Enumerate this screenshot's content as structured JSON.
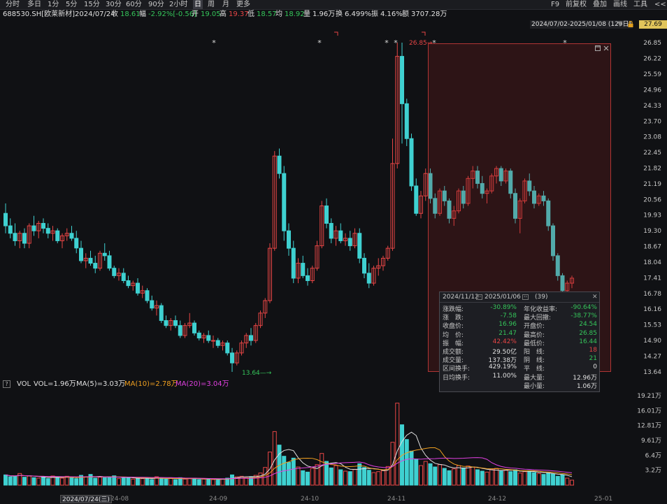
{
  "toolbar": {
    "periods": [
      "分时",
      "多日",
      "1分",
      "5分",
      "15分",
      "30分",
      "60分",
      "90分",
      "2小时",
      "日",
      "周",
      "月",
      "更多"
    ],
    "active_period": "日",
    "right_items": [
      "F9",
      "前复权",
      "叠加",
      "画线",
      "工具",
      "<<"
    ]
  },
  "info": {
    "code": "688530.SH[欧莱新材]",
    "date": "2024/07/24",
    "close_label": "收",
    "close": "18.61",
    "change_label": "幅",
    "change": "-2.92%[-0.56]",
    "open_label": "开",
    "open": "19.05",
    "high_label": "高",
    "high": "19.37",
    "low_label": "低",
    "low": "18.57",
    "avg_label": "均",
    "avg": "18.92",
    "volume_label": "量",
    "volume": "1.96万",
    "turnover_label": "换",
    "turnover": "6.499%",
    "amplitude_label": "振",
    "amplitude": "4.16%",
    "amount_label": "额",
    "amount": "3707.28万"
  },
  "range_label": "2024/07/02-2025/01/08 (129日)",
  "current_price": "27.69",
  "y_axis": [
    "26.85",
    "26.22",
    "25.59",
    "24.96",
    "24.33",
    "23.70",
    "23.08",
    "22.45",
    "21.82",
    "21.19",
    "20.56",
    "19.93",
    "19.30",
    "18.67",
    "18.04",
    "17.41",
    "16.78",
    "16.16",
    "15.53",
    "14.90",
    "14.27",
    "13.64"
  ],
  "annotations": {
    "high_label": "26.85",
    "low_label": "13.64"
  },
  "stat_panel": {
    "range": "2024/11/12",
    "range_end": "2025/01/06",
    "count": "(39)",
    "rows": [
      {
        "l1": "涨跌幅:",
        "v1": "-30.89%",
        "c1": "#35c55a",
        "l2": "年化收益率:",
        "v2": "-90.64%",
        "c2": "#35c55a"
      },
      {
        "l1": "涨　跌:",
        "v1": "-7.58",
        "c1": "#35c55a",
        "l2": "最大回撤:",
        "v2": "-38.77%",
        "c2": "#35c55a"
      },
      {
        "l1": "收盘价:",
        "v1": "16.96",
        "c1": "#35c55a",
        "l2": "开盘价:",
        "v2": "24.54",
        "c2": "#35c55a"
      },
      {
        "l1": "均　价:",
        "v1": "21.47",
        "c1": "#35c55a",
        "l2": "最高价:",
        "v2": "26.85",
        "c2": "#35c55a"
      },
      {
        "l1": "振　幅:",
        "v1": "42.42%",
        "c1": "#e64545",
        "l2": "最低价:",
        "v2": "16.44",
        "c2": "#35c55a"
      },
      {
        "l1": "成交额:",
        "v1": "29.50亿",
        "c1": "#e0e0e0",
        "l2": "阳　线:",
        "v2": "18",
        "c2": "#e64545"
      },
      {
        "l1": "成交量:",
        "v1": "137.38万",
        "c1": "#e0e0e0",
        "l2": "阴　线:",
        "v2": "21",
        "c2": "#35c55a"
      },
      {
        "l1": "区间换手:",
        "v1": "429.19%",
        "c1": "#e0e0e0",
        "l2": "平　线:",
        "v2": "0",
        "c2": "#e0e0e0"
      },
      {
        "l1": "日均换手:",
        "v1": "11.00%",
        "c1": "#e0e0e0",
        "l2": "最大量:",
        "v2": "12.96万",
        "c2": "#e0e0e0"
      },
      {
        "l1": "",
        "v1": "",
        "c1": "#e0e0e0",
        "l2": "最小量:",
        "v2": "1.06万",
        "c2": "#e0e0e0"
      }
    ]
  },
  "volume_legend": {
    "question": "?",
    "name": "VOL",
    "vol": "VOL=1.96万",
    "ma5": "MA(5)=3.03万",
    "ma10": "MA(10)=2.78万",
    "ma20": "MA(20)=3.04万"
  },
  "vol_axis": [
    "19.21万",
    "16.01万",
    "12.81万",
    "9.61万",
    "6.4万",
    "3.2万"
  ],
  "x_axis": [
    "24-08",
    "24-09",
    "24-10",
    "24-11",
    "24-12",
    "25-01"
  ],
  "current_date": "2024/07/24(三)",
  "colors": {
    "up": "#e64545",
    "down": "#3fd1d1",
    "ma5": "#e0e0e0",
    "ma10": "#f0a020",
    "ma20": "#e040e0",
    "bg": "#101114"
  },
  "chart_data": {
    "type": "candlestick",
    "price_range": [
      13.64,
      26.85
    ],
    "candles": [
      [
        20.0,
        20.4,
        19.2,
        19.5
      ],
      [
        19.5,
        19.8,
        19.0,
        19.2
      ],
      [
        19.2,
        19.6,
        18.7,
        18.9
      ],
      [
        18.9,
        19.3,
        18.6,
        19.2
      ],
      [
        19.2,
        19.4,
        18.6,
        18.8
      ],
      [
        18.8,
        19.6,
        18.6,
        19.5
      ],
      [
        19.5,
        19.9,
        19.1,
        19.3
      ],
      [
        19.3,
        19.7,
        19.0,
        19.6
      ],
      [
        19.6,
        19.8,
        19.2,
        19.4
      ],
      [
        19.4,
        19.6,
        19.0,
        19.2
      ],
      [
        19.2,
        19.5,
        18.9,
        19.3
      ],
      [
        19.3,
        19.4,
        18.8,
        18.9
      ],
      [
        18.9,
        19.2,
        18.6,
        19.1
      ],
      [
        19.1,
        19.4,
        18.9,
        19.2
      ],
      [
        19.2,
        19.5,
        18.9,
        19.0
      ],
      [
        19.0,
        19.3,
        18.4,
        18.61
      ],
      [
        18.6,
        18.9,
        18.0,
        18.1
      ],
      [
        18.1,
        18.4,
        17.8,
        18.2
      ],
      [
        18.2,
        18.5,
        17.9,
        18.0
      ],
      [
        18.0,
        18.3,
        17.6,
        17.8
      ],
      [
        17.8,
        18.5,
        17.7,
        18.4
      ],
      [
        18.4,
        18.8,
        18.1,
        18.3
      ],
      [
        18.3,
        18.5,
        17.7,
        17.8
      ],
      [
        17.8,
        17.9,
        17.4,
        17.5
      ],
      [
        17.5,
        17.8,
        17.3,
        17.6
      ],
      [
        17.6,
        17.8,
        17.2,
        17.3
      ],
      [
        17.3,
        17.5,
        17.0,
        17.1
      ],
      [
        17.1,
        17.3,
        16.9,
        17.2
      ],
      [
        17.2,
        17.4,
        16.7,
        16.8
      ],
      [
        16.8,
        17.1,
        16.6,
        16.9
      ],
      [
        16.9,
        17.0,
        16.4,
        16.5
      ],
      [
        16.5,
        16.7,
        16.1,
        16.2
      ],
      [
        16.2,
        16.5,
        15.9,
        16.3
      ],
      [
        16.3,
        16.4,
        15.6,
        15.7
      ],
      [
        15.7,
        15.9,
        15.4,
        15.5
      ],
      [
        15.5,
        15.8,
        15.3,
        15.7
      ],
      [
        15.7,
        15.9,
        15.4,
        15.5
      ],
      [
        15.5,
        15.7,
        15.0,
        15.1
      ],
      [
        15.1,
        15.6,
        15.0,
        15.5
      ],
      [
        15.5,
        16.0,
        15.4,
        15.6
      ],
      [
        15.6,
        15.7,
        15.1,
        15.2
      ],
      [
        15.2,
        15.3,
        14.9,
        15.0
      ],
      [
        15.0,
        15.2,
        14.8,
        15.1
      ],
      [
        15.1,
        15.3,
        14.8,
        14.9
      ],
      [
        14.9,
        15.1,
        14.6,
        14.9
      ],
      [
        14.9,
        15.0,
        14.6,
        14.7
      ],
      [
        14.7,
        14.9,
        14.5,
        14.8
      ],
      [
        14.8,
        14.9,
        14.3,
        14.4
      ],
      [
        14.4,
        14.6,
        13.64,
        14.0
      ],
      [
        14.0,
        14.5,
        13.9,
        14.4
      ],
      [
        14.4,
        14.9,
        14.3,
        14.8
      ],
      [
        14.8,
        15.2,
        14.6,
        15.1
      ],
      [
        15.1,
        15.4,
        14.7,
        14.9
      ],
      [
        14.9,
        15.6,
        14.8,
        15.5
      ],
      [
        15.5,
        16.1,
        15.4,
        16.0
      ],
      [
        16.0,
        16.6,
        15.8,
        16.5
      ],
      [
        16.5,
        18.8,
        16.4,
        18.6
      ],
      [
        18.6,
        22.5,
        18.5,
        22.3
      ],
      [
        22.3,
        22.6,
        21.4,
        21.6
      ],
      [
        21.6,
        21.9,
        18.9,
        19.3
      ],
      [
        19.3,
        19.6,
        18.3,
        18.6
      ],
      [
        18.6,
        18.9,
        17.2,
        17.4
      ],
      [
        17.4,
        18.2,
        17.2,
        18.0
      ],
      [
        18.0,
        18.3,
        17.4,
        17.5
      ],
      [
        17.5,
        17.8,
        17.1,
        17.3
      ],
      [
        17.3,
        17.9,
        17.2,
        17.8
      ],
      [
        17.8,
        18.9,
        17.7,
        18.7
      ],
      [
        18.7,
        20.5,
        18.6,
        20.3
      ],
      [
        20.3,
        20.6,
        19.4,
        19.6
      ],
      [
        19.6,
        19.8,
        18.8,
        19.0
      ],
      [
        19.0,
        19.5,
        18.7,
        19.3
      ],
      [
        19.3,
        19.6,
        18.8,
        18.9
      ],
      [
        18.9,
        19.2,
        18.7,
        19.0
      ],
      [
        19.0,
        19.3,
        18.5,
        18.7
      ],
      [
        18.7,
        19.4,
        18.6,
        19.2
      ],
      [
        19.2,
        19.4,
        18.0,
        18.2
      ],
      [
        18.2,
        18.4,
        17.4,
        17.6
      ],
      [
        17.6,
        18.0,
        17.0,
        17.2
      ],
      [
        17.2,
        17.9,
        17.1,
        17.8
      ],
      [
        17.8,
        18.2,
        17.5,
        17.9
      ],
      [
        17.9,
        18.3,
        17.7,
        18.2
      ],
      [
        18.2,
        18.7,
        18.1,
        18.6
      ],
      [
        18.6,
        23.0,
        18.5,
        22.0
      ],
      [
        22.0,
        26.85,
        21.8,
        26.3
      ],
      [
        26.3,
        26.85,
        22.8,
        24.4
      ],
      [
        24.4,
        24.6,
        22.7,
        23.0
      ],
      [
        23.0,
        23.2,
        20.9,
        21.1
      ],
      [
        21.1,
        21.4,
        19.9,
        20.0
      ],
      [
        20.0,
        20.9,
        19.8,
        20.7
      ],
      [
        20.7,
        21.8,
        20.5,
        21.6
      ],
      [
        21.6,
        21.8,
        20.4,
        20.6
      ],
      [
        20.6,
        20.8,
        19.8,
        20.0
      ],
      [
        20.0,
        21.0,
        19.9,
        20.9
      ],
      [
        20.9,
        21.1,
        20.3,
        20.5
      ],
      [
        20.5,
        20.6,
        19.6,
        19.8
      ],
      [
        19.8,
        20.3,
        19.5,
        20.1
      ],
      [
        20.1,
        21.0,
        20.0,
        20.9
      ],
      [
        20.9,
        21.1,
        20.2,
        20.4
      ],
      [
        20.4,
        21.5,
        20.3,
        21.4
      ],
      [
        21.4,
        21.9,
        21.0,
        21.7
      ],
      [
        21.7,
        21.9,
        21.0,
        21.2
      ],
      [
        21.2,
        21.5,
        20.6,
        20.8
      ],
      [
        20.8,
        21.0,
        20.4,
        20.9
      ],
      [
        20.9,
        21.6,
        20.8,
        21.5
      ],
      [
        21.5,
        21.9,
        21.2,
        21.8
      ],
      [
        21.8,
        21.9,
        21.1,
        21.3
      ],
      [
        21.3,
        21.8,
        21.2,
        21.7
      ],
      [
        21.7,
        21.8,
        20.6,
        20.8
      ],
      [
        20.8,
        21.0,
        19.6,
        19.8
      ],
      [
        19.8,
        20.6,
        19.2,
        20.5
      ],
      [
        20.5,
        21.4,
        20.4,
        21.3
      ],
      [
        21.3,
        21.6,
        20.7,
        20.9
      ],
      [
        20.9,
        21.1,
        20.2,
        20.4
      ],
      [
        20.4,
        20.8,
        20.3,
        20.7
      ],
      [
        20.7,
        20.9,
        20.3,
        20.5
      ],
      [
        20.5,
        20.6,
        19.3,
        19.5
      ],
      [
        19.5,
        19.6,
        18.1,
        18.3
      ],
      [
        18.3,
        18.4,
        17.3,
        17.5
      ],
      [
        17.5,
        17.6,
        16.8,
        16.9
      ],
      [
        16.9,
        17.3,
        16.7,
        17.2
      ],
      [
        17.2,
        17.5,
        17.0,
        17.4
      ]
    ],
    "volumes": [
      2.2,
      1.8,
      1.9,
      2.5,
      1.7,
      2.0,
      1.6,
      1.5,
      1.8,
      1.4,
      1.96,
      1.7,
      1.5,
      1.9,
      1.6,
      1.4,
      2.1,
      1.8,
      2.3,
      1.5,
      1.7,
      1.6,
      1.8,
      2.0,
      1.4,
      1.5,
      1.7,
      1.3,
      1.5,
      1.4,
      1.6,
      1.2,
      1.8,
      1.4,
      1.3,
      1.5,
      1.2,
      1.6,
      1.3,
      1.4,
      1.5,
      1.2,
      1.3,
      1.4,
      1.2,
      1.1,
      1.3,
      1.5,
      2.2,
      1.8,
      1.9,
      1.6,
      1.7,
      2.1,
      2.6,
      3.8,
      7.1,
      11.5,
      8.6,
      6.2,
      4.9,
      5.8,
      3.9,
      3.1,
      2.8,
      3.6,
      4.4,
      6.8,
      5.1,
      3.7,
      4.2,
      3.3,
      3.0,
      2.9,
      3.4,
      4.6,
      3.8,
      3.2,
      2.7,
      2.9,
      3.1,
      4.0,
      9.2,
      17.6,
      12.96,
      9.8,
      7.3,
      5.6,
      4.2,
      5.1,
      4.6,
      3.9,
      4.4,
      3.6,
      3.1,
      3.5,
      4.2,
      3.7,
      4.1,
      3.9,
      3.3,
      3.0,
      2.8,
      3.4,
      3.6,
      3.0,
      3.2,
      2.9,
      3.3,
      2.6,
      2.9,
      3.1,
      2.7,
      2.5,
      2.3,
      2.6,
      2.4,
      1.9,
      2.2,
      1.5,
      1.06,
      1.4,
      1.2,
      1.9,
      1.6,
      1.96,
      1.7,
      1.4,
      1.3
    ],
    "volume_range": [
      0,
      19.21
    ],
    "selection": {
      "start_index": 90,
      "end_index": 128
    }
  }
}
